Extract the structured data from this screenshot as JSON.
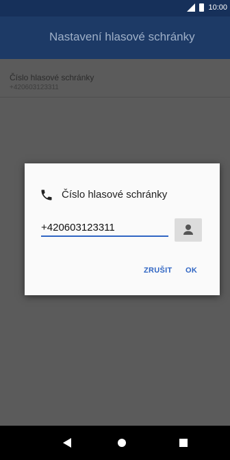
{
  "status_bar": {
    "time": "10:00",
    "signal_icon": "signal-icon",
    "battery_icon": "battery-icon"
  },
  "app_bar": {
    "title": "Nastavení hlasové schránky"
  },
  "setting": {
    "title": "Číslo hlasové schránky",
    "value": "+420603123311"
  },
  "dialog": {
    "title": "Číslo hlasové schránky",
    "title_icon": "phone-icon",
    "input_value": "+420603123311",
    "contact_icon": "contact-icon",
    "cancel_label": "ZRUŠIT",
    "ok_label": "OK"
  },
  "nav_bar": {
    "back_icon": "back-icon",
    "home_icon": "home-icon",
    "recents_icon": "recents-icon"
  },
  "colors": {
    "accent": "#2f65c3",
    "app_bar": "#1d3a66",
    "status_bar": "#16305a"
  }
}
